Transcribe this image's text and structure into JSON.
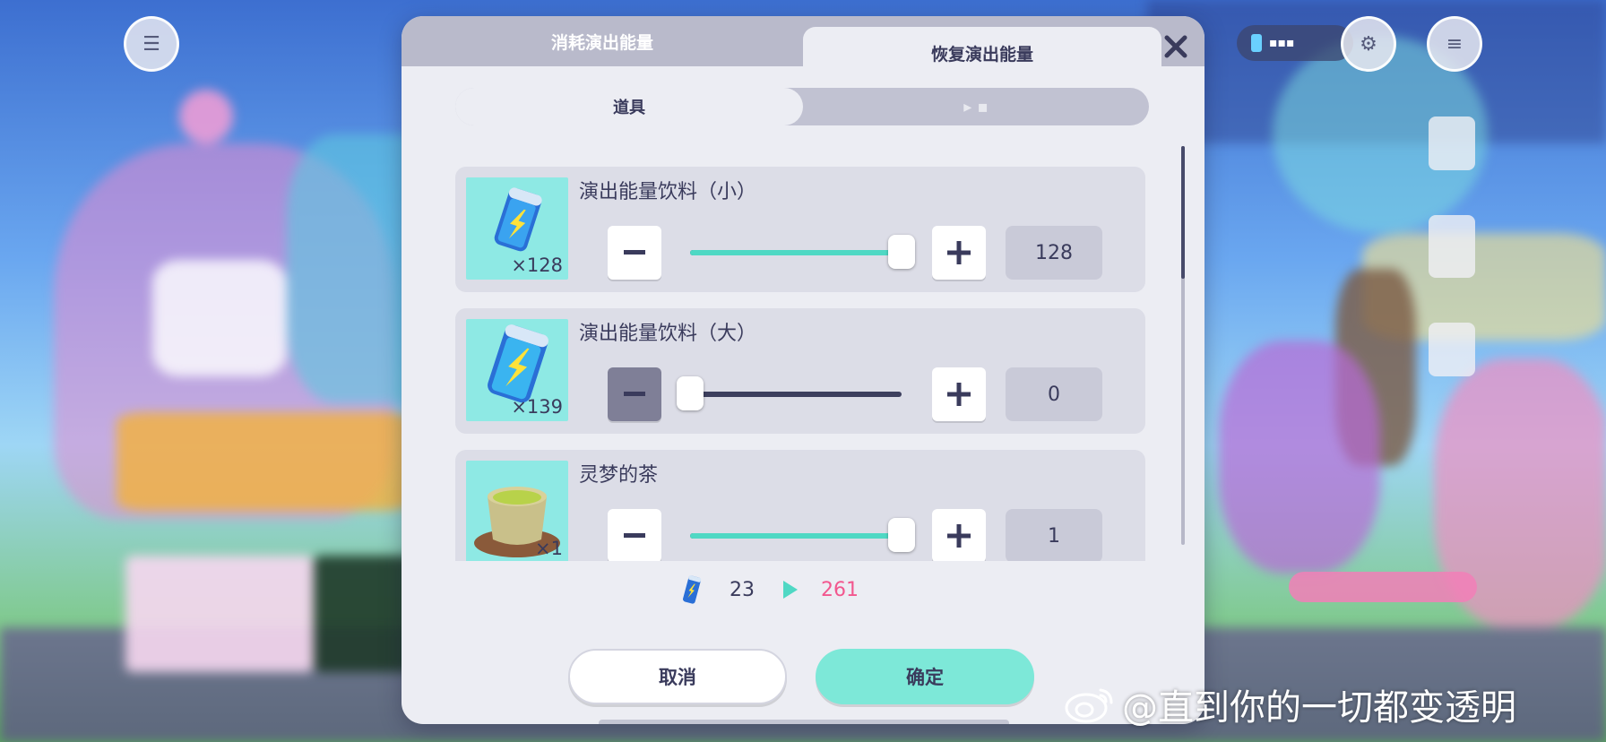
{
  "tabs": {
    "consume": "消耗演出能量",
    "restore": "恢复演出能量"
  },
  "segment": {
    "items": "道具",
    "other": "▸ ▪"
  },
  "items": [
    {
      "name": "演出能量饮料（小）",
      "owned": "×128",
      "value": "128",
      "slider_fraction": 1.0,
      "icon": "energy-drink-small-icon"
    },
    {
      "name": "演出能量饮料（大）",
      "owned": "×139",
      "value": "0",
      "slider_fraction": 0.0,
      "icon": "energy-drink-large-icon"
    },
    {
      "name": "灵梦的茶",
      "owned": "×1",
      "value": "1",
      "slider_fraction": 1.0,
      "icon": "tea-cup-icon"
    }
  ],
  "summary": {
    "current": "23",
    "after": "261"
  },
  "buttons": {
    "cancel": "取消",
    "confirm": "确定"
  },
  "watermark": "@直到你的一切都变透明",
  "colors": {
    "accent": "#4fd8c4",
    "confirm": "#7de8d8",
    "highlight_number": "#f2578e",
    "text": "#3a3b5c"
  }
}
